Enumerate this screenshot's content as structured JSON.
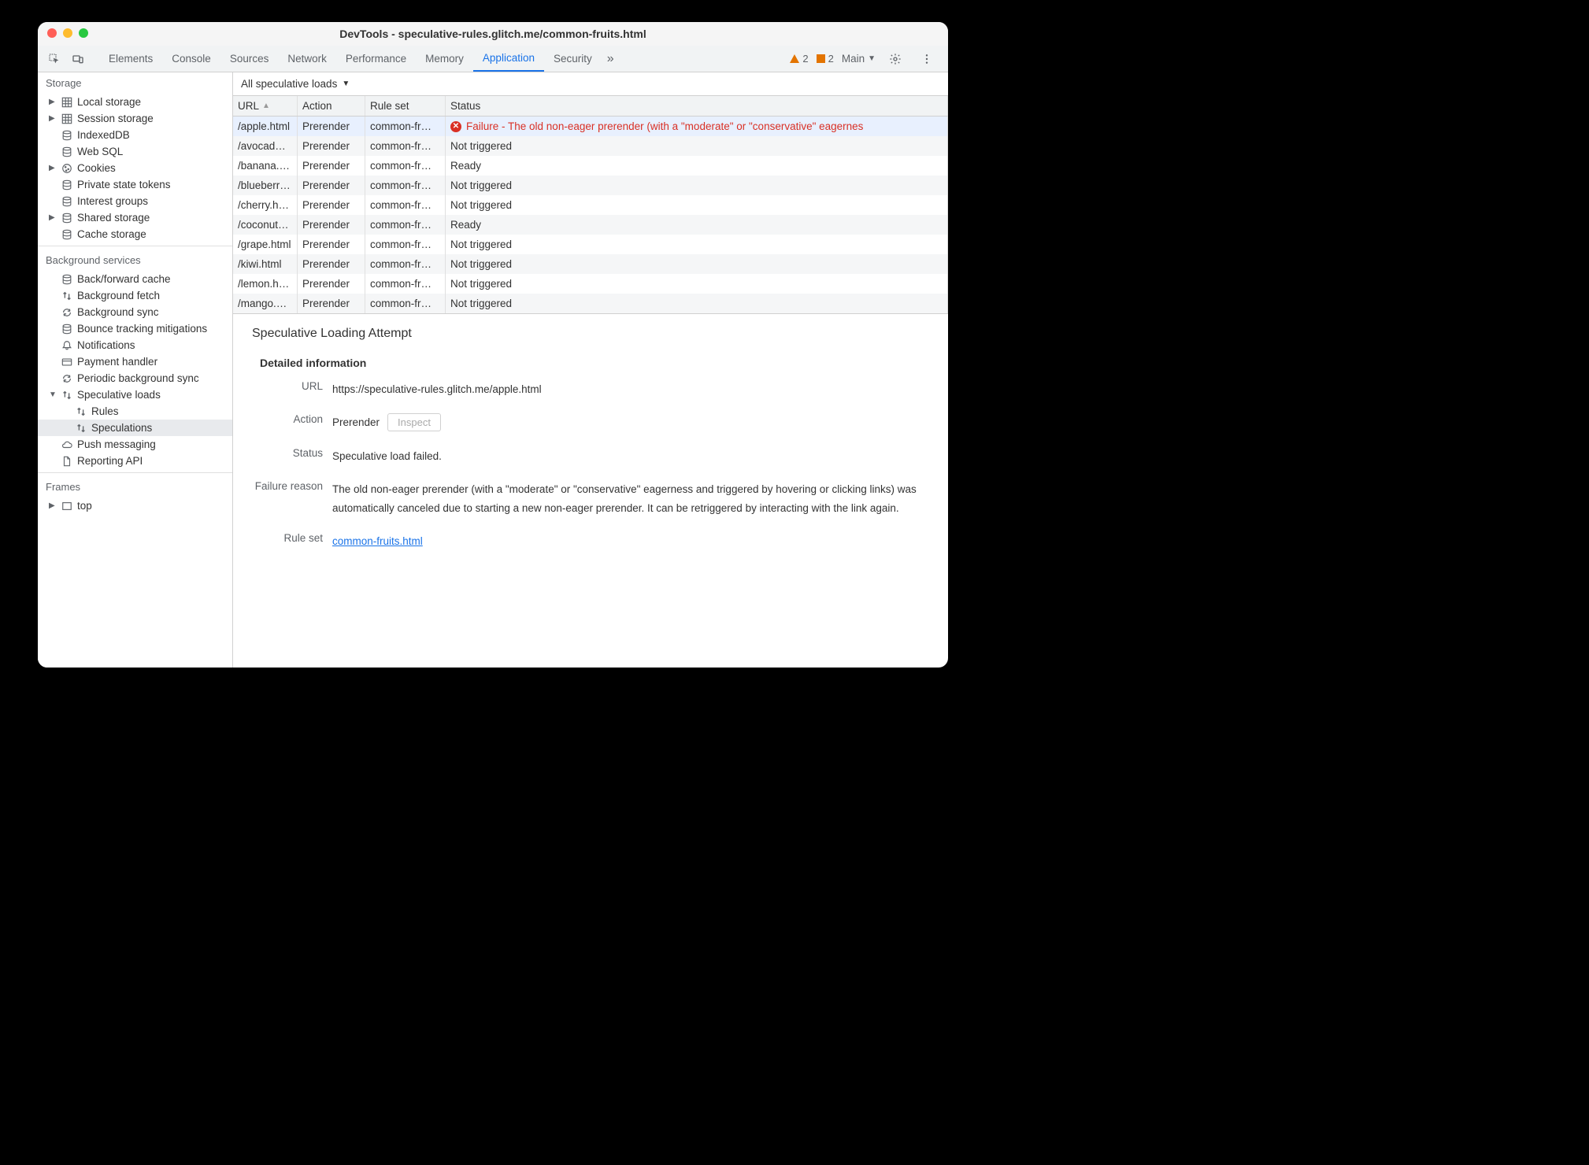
{
  "window_title": "DevTools - speculative-rules.glitch.me/common-fruits.html",
  "tabs": [
    "Elements",
    "Console",
    "Sources",
    "Network",
    "Performance",
    "Memory",
    "Application",
    "Security"
  ],
  "active_tab": "Application",
  "warning_count": "2",
  "error_count": "2",
  "main_label": "Main",
  "sidebar": {
    "storage_title": "Storage",
    "storage": [
      {
        "label": "Local storage",
        "exp": "▶"
      },
      {
        "label": "Session storage",
        "exp": "▶"
      },
      {
        "label": "IndexedDB"
      },
      {
        "label": "Web SQL"
      },
      {
        "label": "Cookies",
        "exp": "▶"
      },
      {
        "label": "Private state tokens"
      },
      {
        "label": "Interest groups"
      },
      {
        "label": "Shared storage",
        "exp": "▶"
      },
      {
        "label": "Cache storage"
      }
    ],
    "bg_title": "Background services",
    "bg": [
      {
        "label": "Back/forward cache"
      },
      {
        "label": "Background fetch"
      },
      {
        "label": "Background sync"
      },
      {
        "label": "Bounce tracking mitigations"
      },
      {
        "label": "Notifications"
      },
      {
        "label": "Payment handler"
      },
      {
        "label": "Periodic background sync"
      },
      {
        "label": "Speculative loads",
        "exp": "▼"
      },
      {
        "label": "Rules",
        "indent": true
      },
      {
        "label": "Speculations",
        "indent": true,
        "selected": true
      },
      {
        "label": "Push messaging"
      },
      {
        "label": "Reporting API"
      }
    ],
    "frames_title": "Frames",
    "frames": [
      {
        "label": "top",
        "exp": "▶"
      }
    ]
  },
  "filter_label": "All speculative loads",
  "columns": {
    "url": "URL",
    "action": "Action",
    "ruleset": "Rule set",
    "status": "Status"
  },
  "rows": [
    {
      "url": "/apple.html",
      "action": "Prerender",
      "ruleset": "common-fr…",
      "status": "Failure - The old non-eager prerender (with a \"moderate\" or \"conservative\" eagernes",
      "error": true
    },
    {
      "url": "/avocad…",
      "action": "Prerender",
      "ruleset": "common-fr…",
      "status": "Not triggered"
    },
    {
      "url": "/banana.…",
      "action": "Prerender",
      "ruleset": "common-fr…",
      "status": "Ready"
    },
    {
      "url": "/blueberr…",
      "action": "Prerender",
      "ruleset": "common-fr…",
      "status": "Not triggered"
    },
    {
      "url": "/cherry.h…",
      "action": "Prerender",
      "ruleset": "common-fr…",
      "status": "Not triggered"
    },
    {
      "url": "/coconut…",
      "action": "Prerender",
      "ruleset": "common-fr…",
      "status": "Ready"
    },
    {
      "url": "/grape.html",
      "action": "Prerender",
      "ruleset": "common-fr…",
      "status": "Not triggered"
    },
    {
      "url": "/kiwi.html",
      "action": "Prerender",
      "ruleset": "common-fr…",
      "status": "Not triggered"
    },
    {
      "url": "/lemon.h…",
      "action": "Prerender",
      "ruleset": "common-fr…",
      "status": "Not triggered"
    },
    {
      "url": "/mango.…",
      "action": "Prerender",
      "ruleset": "common-fr…",
      "status": "Not triggered"
    }
  ],
  "detail": {
    "title": "Speculative Loading Attempt",
    "section": "Detailed information",
    "labels": {
      "url": "URL",
      "action": "Action",
      "status": "Status",
      "failure": "Failure reason",
      "ruleset": "Rule set"
    },
    "url": "https://speculative-rules.glitch.me/apple.html",
    "action": "Prerender",
    "inspect": "Inspect",
    "status": "Speculative load failed.",
    "failure": "The old non-eager prerender (with a \"moderate\" or \"conservative\" eagerness and triggered by hovering or clicking links) was automatically canceled due to starting a new non-eager prerender. It can be retriggered by interacting with the link again.",
    "ruleset": "common-fruits.html"
  }
}
